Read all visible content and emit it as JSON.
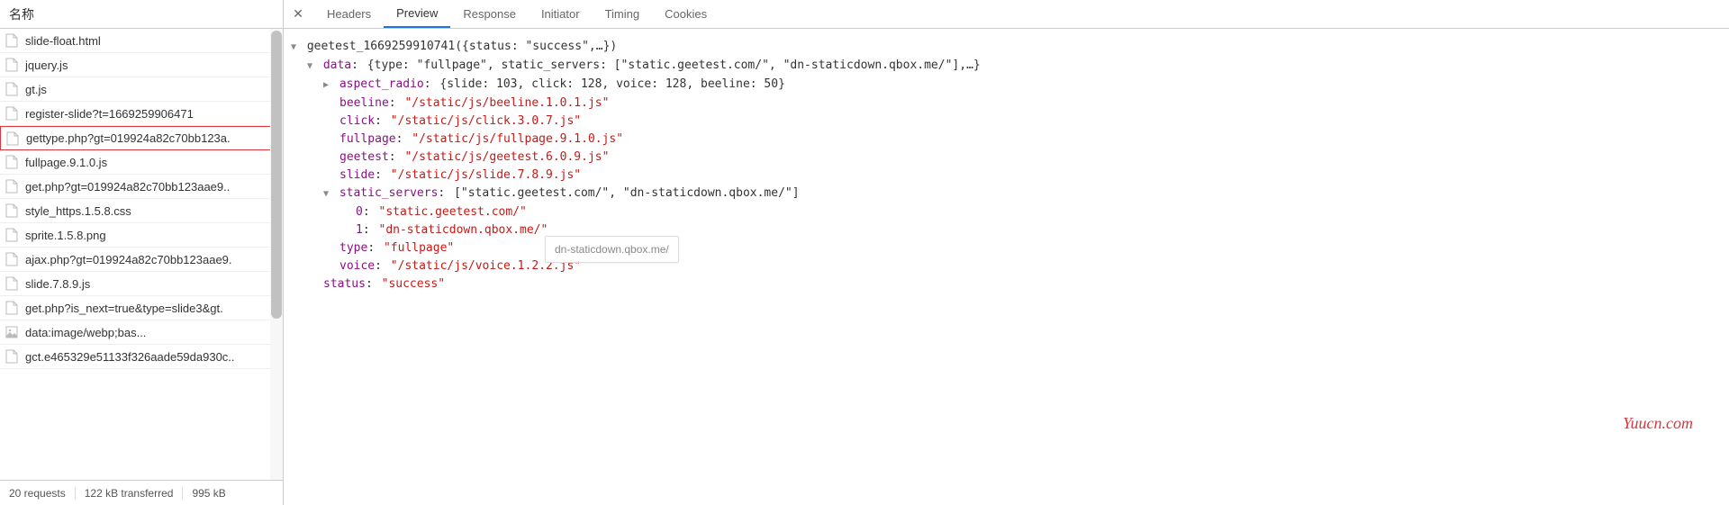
{
  "left_header": "名称",
  "requests": [
    {
      "name": "slide-float.html",
      "icon": "doc"
    },
    {
      "name": "jquery.js",
      "icon": "doc"
    },
    {
      "name": "gt.js",
      "icon": "doc"
    },
    {
      "name": "register-slide?t=1669259906471",
      "icon": "doc"
    },
    {
      "name": "gettype.php?gt=019924a82c70bb123a.",
      "icon": "doc",
      "highlighted": true
    },
    {
      "name": "fullpage.9.1.0.js",
      "icon": "doc"
    },
    {
      "name": "get.php?gt=019924a82c70bb123aae9..",
      "icon": "doc"
    },
    {
      "name": "style_https.1.5.8.css",
      "icon": "doc"
    },
    {
      "name": "sprite.1.5.8.png",
      "icon": "doc"
    },
    {
      "name": "ajax.php?gt=019924a82c70bb123aae9.",
      "icon": "doc"
    },
    {
      "name": "slide.7.8.9.js",
      "icon": "doc"
    },
    {
      "name": "get.php?is_next=true&type=slide3&gt.",
      "icon": "doc"
    },
    {
      "name": "data:image/webp;bas...",
      "icon": "img"
    },
    {
      "name": "gct.e465329e51133f326aade59da930c..",
      "icon": "doc"
    }
  ],
  "footer": {
    "requests": "20 requests",
    "transferred": "122 kB transferred",
    "resources": "995 kB"
  },
  "tabs": [
    "Headers",
    "Preview",
    "Response",
    "Initiator",
    "Timing",
    "Cookies"
  ],
  "active_tab": 1,
  "preview": {
    "fn": "geetest_1669259910741",
    "fn_args_preview": "{status: \"success\",…}",
    "data_prefix": "{type: \"fullpage\", static_servers: [\"static.geetest.com/\", \"dn-staticdown.qbox.me/\"],…}",
    "aspect_radio_preview": "{slide: 103, click: 128, voice: 128, beeline: 50}",
    "data": {
      "beeline": "/static/js/beeline.1.0.1.js",
      "click": "/static/js/click.3.0.7.js",
      "fullpage": "/static/js/fullpage.9.1.0.js",
      "geetest": "/static/js/geetest.6.0.9.js",
      "slide": "/static/js/slide.7.8.9.js",
      "static_servers_preview": "[\"static.geetest.com/\", \"dn-staticdown.qbox.me/\"]",
      "static_servers": [
        "static.geetest.com/",
        "dn-staticdown.qbox.me/"
      ],
      "type": "fullpage",
      "voice": "/static/js/voice.1.2.2.js"
    },
    "status": "success"
  },
  "tooltip": "dn-staticdown.qbox.me/",
  "watermark": "Yuucn.com"
}
